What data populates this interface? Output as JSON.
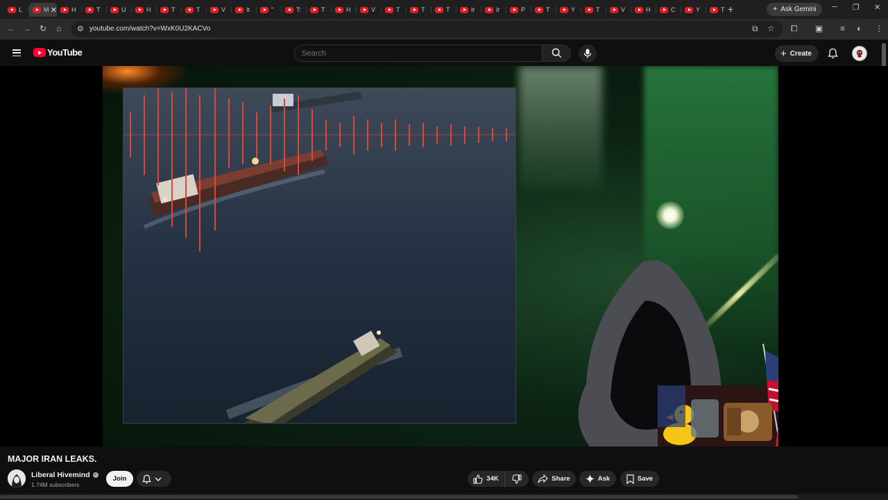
{
  "browser": {
    "tabs": [
      {
        "letter": "L"
      },
      {
        "letter": "M",
        "active": true
      },
      {
        "letter": "H"
      },
      {
        "letter": "T"
      },
      {
        "letter": "U"
      },
      {
        "letter": "H"
      },
      {
        "letter": "T"
      },
      {
        "letter": "T"
      },
      {
        "letter": "V"
      },
      {
        "letter": "It"
      },
      {
        "letter": "\""
      },
      {
        "letter": "T:"
      },
      {
        "letter": "T"
      },
      {
        "letter": "H"
      },
      {
        "letter": "V"
      },
      {
        "letter": "T"
      },
      {
        "letter": "T"
      },
      {
        "letter": "T"
      },
      {
        "letter": "Ir"
      },
      {
        "letter": "Ir"
      },
      {
        "letter": "P"
      },
      {
        "letter": "T"
      },
      {
        "letter": "Y"
      },
      {
        "letter": "T"
      },
      {
        "letter": "V"
      },
      {
        "letter": "H"
      },
      {
        "letter": "C"
      },
      {
        "letter": "Y"
      },
      {
        "letter": "T"
      }
    ],
    "ask_gemini_label": "Ask Gemini",
    "url": "youtube.com/watch?v=WxK0U2KACVo"
  },
  "youtube": {
    "logo_text": "YouTube",
    "search_placeholder": "Search",
    "create_label": "Create",
    "brand_color": "#ff0033"
  },
  "video": {
    "title": "MAJOR IRAN LEAKS.",
    "channel": {
      "name": "Liberal Hivemind",
      "subscribers": "1.74M subscribers",
      "verified": true
    },
    "actions": {
      "join": "Join",
      "likes": "34K",
      "share": "Share",
      "ask": "Ask",
      "save": "Save"
    }
  },
  "icons": [
    "youtube-favicon-icon",
    "close-icon",
    "plus-icon",
    "gemini-star-icon",
    "back-icon",
    "forward-icon",
    "reload-icon",
    "home-icon",
    "site-info-icon",
    "install-icon",
    "bookmark-star-icon",
    "extensions-icon",
    "media-icon",
    "reading-list-icon",
    "profile-icon",
    "menu-icon",
    "hamburger-icon",
    "search-icon",
    "mic-icon",
    "bell-icon",
    "avatar-icon",
    "like-icon",
    "dislike-icon",
    "share-icon",
    "ask-sparkle-icon",
    "save-icon",
    "verified-icon"
  ]
}
